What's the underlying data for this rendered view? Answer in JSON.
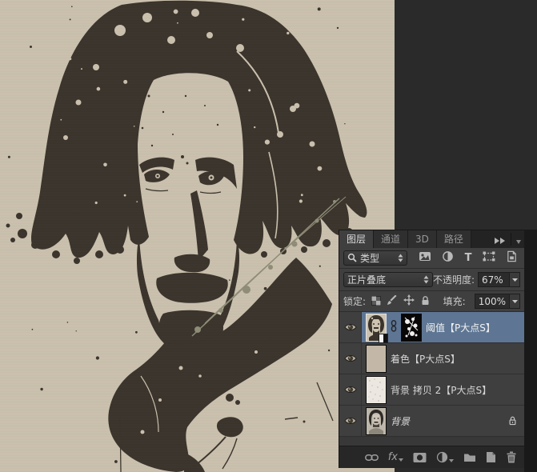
{
  "canvas": {
    "description": "threshold paint-splatter portrait artwork",
    "background": "#cbc1ae",
    "ink": "#3a342c",
    "accent_splatter": "#8f8d77"
  },
  "panel": {
    "tabs": [
      {
        "label": "图层",
        "active": true
      },
      {
        "label": "通道",
        "active": false
      },
      {
        "label": "3D",
        "active": false
      },
      {
        "label": "路径",
        "active": false
      }
    ],
    "filter_bar": {
      "search_label": "类型",
      "icons": [
        "pixel-layer-filter",
        "adjustment-layer-filter",
        "type-layer-filter",
        "shape-layer-filter",
        "smart-object-filter"
      ]
    },
    "blend_bar": {
      "blend_mode": "正片叠底",
      "opacity_label": "不透明度:",
      "opacity_value": "67%"
    },
    "lock_bar": {
      "lock_label": "锁定:",
      "lock_icons": [
        "lock-transparent-pixels",
        "lock-image-pixels",
        "lock-position",
        "lock-all"
      ],
      "fill_label": "填充:",
      "fill_value": "100%"
    },
    "layers": [
      {
        "name": "阈值【P大点S】",
        "selected": true,
        "visible": true,
        "has_mask": true,
        "linked": true,
        "kind": "threshold-adjustment"
      },
      {
        "name": "着色【P大点S】",
        "selected": false,
        "visible": true,
        "kind": "solid-color"
      },
      {
        "name": "背景 拷贝 2【P大点S】",
        "selected": false,
        "visible": true,
        "kind": "pixel"
      },
      {
        "name": "背景",
        "selected": false,
        "visible": true,
        "locked": true,
        "kind": "background"
      }
    ],
    "footer": {
      "fx_label": "fx",
      "icons": [
        "link-layers",
        "layer-style-fx",
        "add-layer-mask",
        "new-adjustment-layer",
        "new-group",
        "new-layer",
        "delete-layer"
      ]
    }
  },
  "colors": {
    "panel_bg": "#3f3f3f",
    "panel_dark": "#272727",
    "selected_row": "#5e7694",
    "workspace": "#2a2a2a",
    "text": "#d6d6d6"
  }
}
